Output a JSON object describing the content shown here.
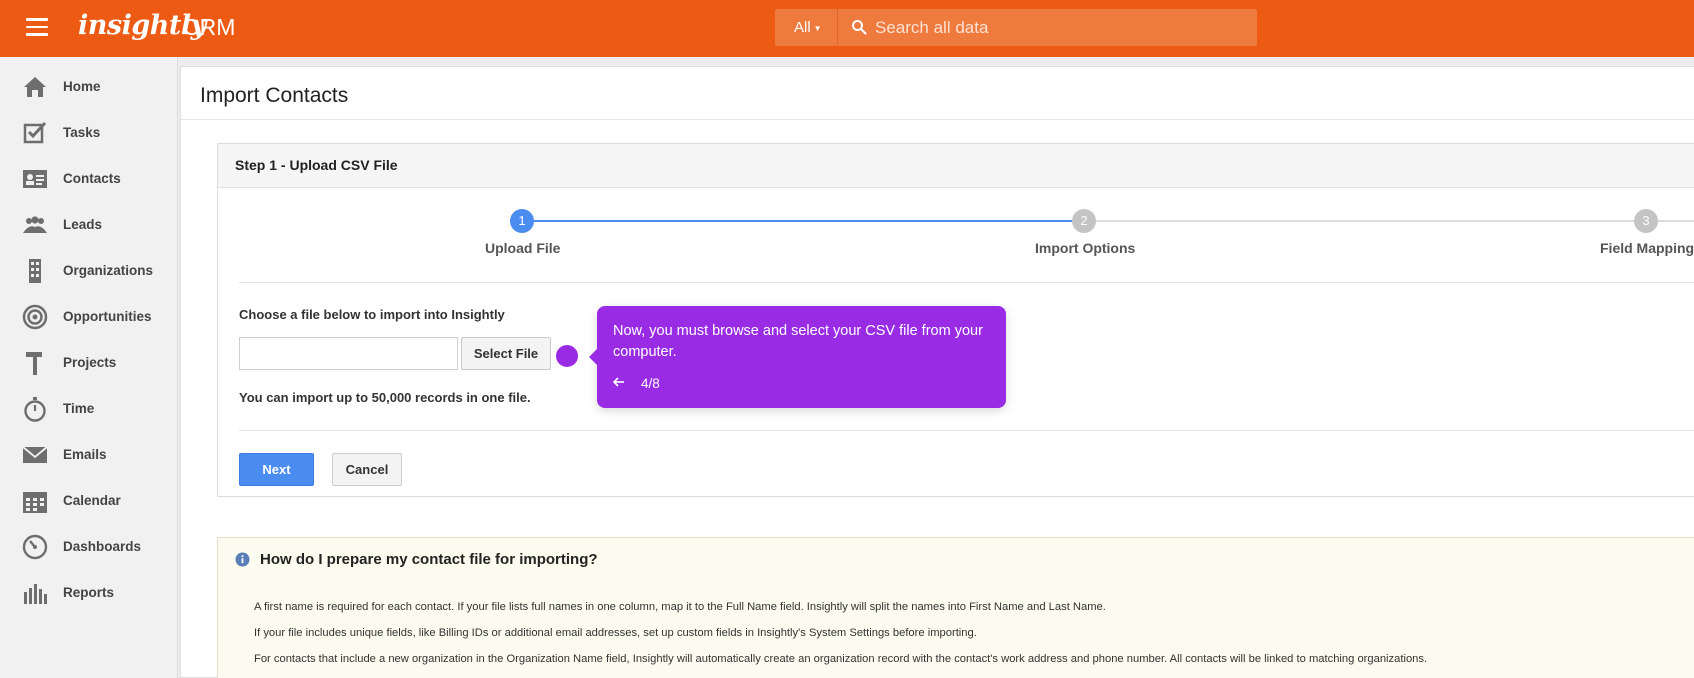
{
  "header": {
    "menu_icon": "hamburger-icon",
    "logo_text": "insightly",
    "app_label": "CRM",
    "search": {
      "scope_label": "All",
      "placeholder": "Search all data",
      "icon": "search-icon"
    },
    "colors": {
      "brand": "#ec5a13",
      "search_bg": "#ef7a3e"
    }
  },
  "sidebar": {
    "items": [
      {
        "label": "Home",
        "icon": "home-icon"
      },
      {
        "label": "Tasks",
        "icon": "checkbox-icon"
      },
      {
        "label": "Contacts",
        "icon": "contact-card-icon"
      },
      {
        "label": "Leads",
        "icon": "people-icon"
      },
      {
        "label": "Organizations",
        "icon": "building-icon"
      },
      {
        "label": "Opportunities",
        "icon": "target-icon"
      },
      {
        "label": "Projects",
        "icon": "hammer-icon"
      },
      {
        "label": "Time",
        "icon": "stopwatch-icon"
      },
      {
        "label": "Emails",
        "icon": "envelope-icon"
      },
      {
        "label": "Calendar",
        "icon": "calendar-icon"
      },
      {
        "label": "Dashboards",
        "icon": "gauge-icon"
      },
      {
        "label": "Reports",
        "icon": "bar-chart-icon"
      }
    ]
  },
  "page": {
    "title": "Import Contacts",
    "step_panel": {
      "title": "Step 1 - Upload CSV File",
      "steps": [
        {
          "number": "1",
          "label": "Upload File",
          "state": "active"
        },
        {
          "number": "2",
          "label": "Import Options",
          "state": "pending"
        },
        {
          "number": "3",
          "label": "Field Mapping",
          "state": "pending"
        }
      ],
      "choose_text": "Choose a file below to import into Insightly",
      "file_value": "",
      "select_file_label": "Select File",
      "limit_text": "You can import up to 50,000 records in one file.",
      "next_label": "Next",
      "cancel_label": "Cancel"
    },
    "help": {
      "icon": "info-icon",
      "title": "How do I prepare my contact file for importing?",
      "lines": [
        "A first name is required for each contact. If your file lists full names in one column, map it to the Full Name field. Insightly will split the names into First Name and Last Name.",
        "If your file includes unique fields, like Billing IDs or additional email addresses, set up custom fields in Insightly's System Settings before importing.",
        "For contacts that include a new organization in the Organization Name field, Insightly will automatically create an organization record with the contact's work address and phone number. All contacts will be linked to matching organizations."
      ]
    }
  },
  "tour": {
    "text": "Now, you must browse and select your CSV file from your computer.",
    "progress": "4/8",
    "back_icon": "arrow-left-icon",
    "color": "#9a2be5"
  },
  "colors": {
    "accent_blue": "#4a8cf0",
    "step_pending": "#c4c4c4"
  }
}
